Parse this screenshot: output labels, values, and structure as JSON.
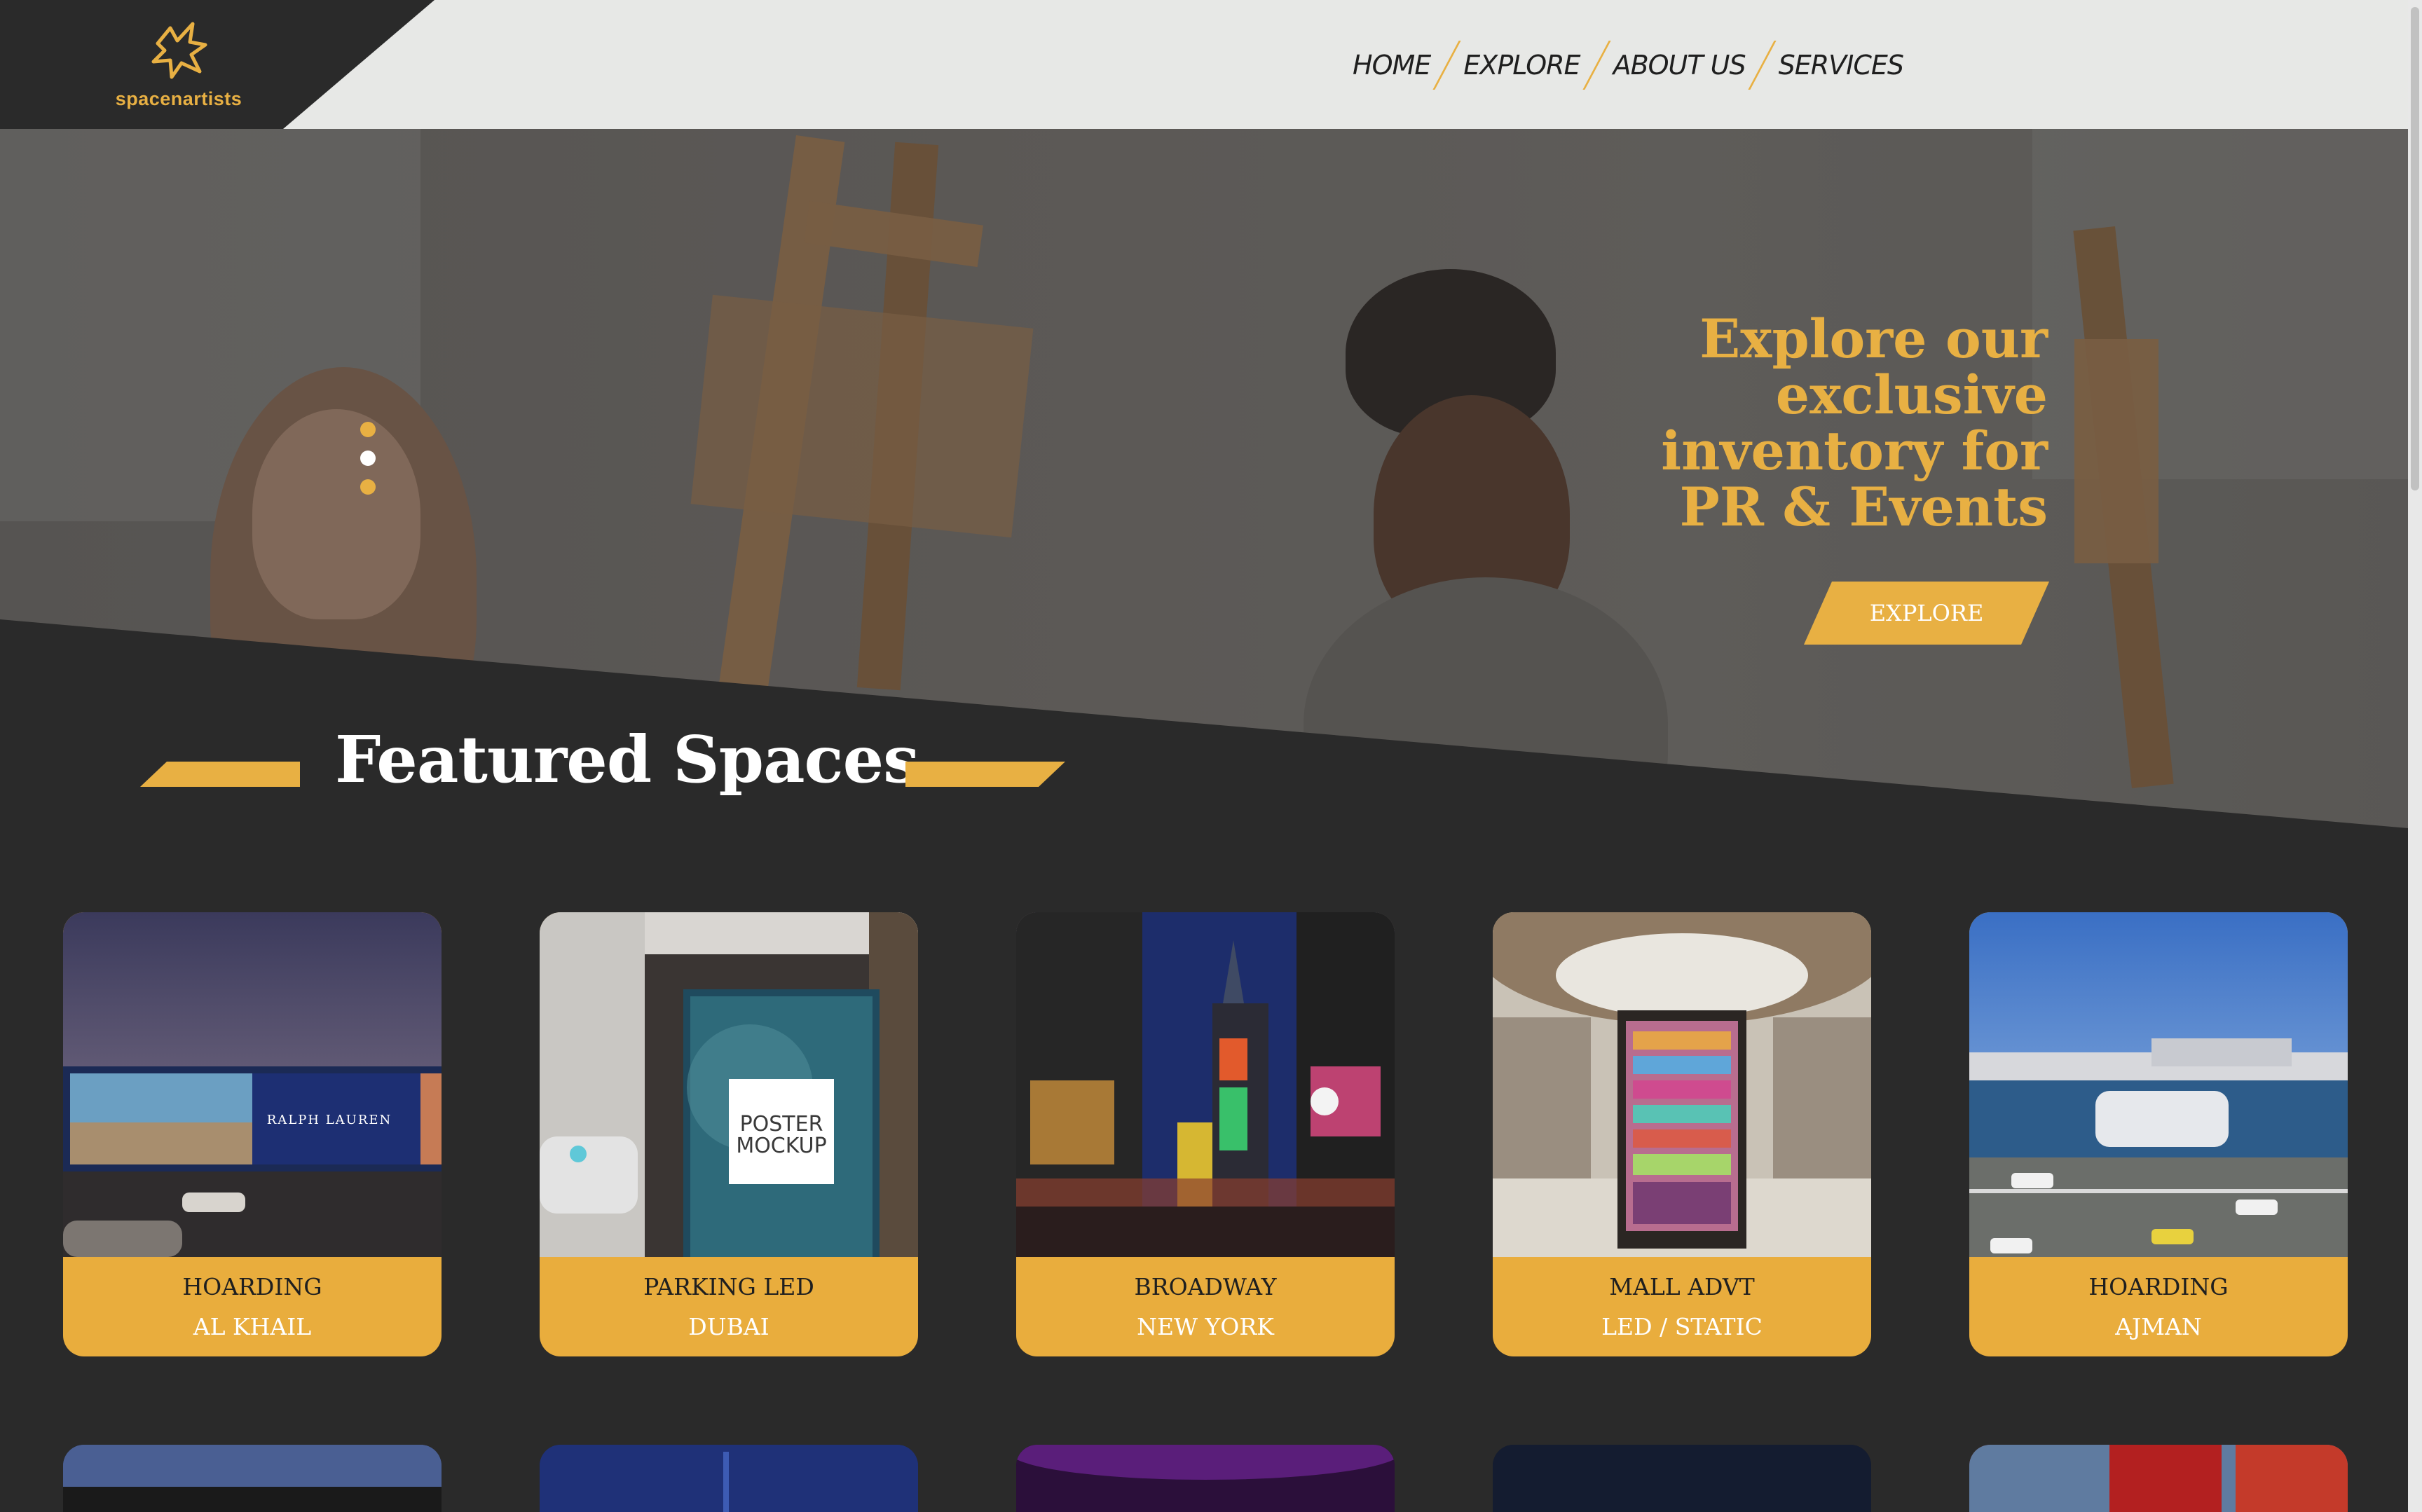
{
  "brand": {
    "name": "spacenartists",
    "logo_icon": "star-burst-icon",
    "color": "#e8b043"
  },
  "nav": {
    "items": [
      "HOME",
      "EXPLORE",
      "ABOUT US",
      "SERVICES"
    ]
  },
  "hero": {
    "title_lines": [
      "Explore our",
      "exclusive",
      "inventory for",
      "PR & Events"
    ],
    "button": "EXPLORE",
    "slides": 3,
    "active_slide": 2
  },
  "featured": {
    "title": "Featured Spaces"
  },
  "cards": [
    {
      "line1": "HOARDING",
      "line2": "AL KHAIL",
      "image": "billboard-highway-night"
    },
    {
      "line1": "PARKING LED",
      "line2": "DUBAI",
      "image": "parking-poster-mockup"
    },
    {
      "line1": "BROADWAY",
      "line2": "NEW YORK",
      "image": "times-square-night"
    },
    {
      "line1": "MALL ADVT",
      "line2": "LED / STATIC",
      "image": "mall-kiosk-display"
    },
    {
      "line1": "HOARDING",
      "line2": "AJMAN",
      "image": "highway-billboard-day"
    }
  ],
  "poster_text": {
    "line1": "POSTER",
    "line2": "MOCKUP"
  },
  "billboard_text": "RALPH LAUREN",
  "colors": {
    "accent": "#e8b043",
    "dark": "#2a2a2a",
    "header": "#e7e8e6"
  }
}
